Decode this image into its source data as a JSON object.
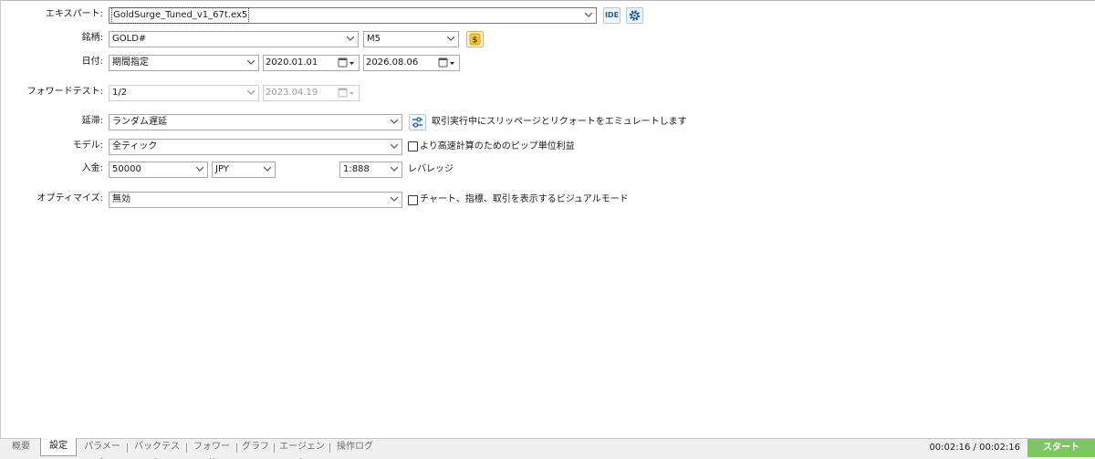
{
  "form": {
    "expert": {
      "label": "エキスパート:",
      "value": "GoldSurge_Tuned_v1_67t.ex5"
    },
    "symbol": {
      "label": "銘柄:",
      "value": "GOLD#",
      "timeframe": "M5"
    },
    "date": {
      "label": "日付:",
      "mode": "期間指定",
      "from": "2020.01.01",
      "to": "2026.08.06"
    },
    "forward": {
      "label": "フォワードテスト:",
      "value": "1/2",
      "date": "2023.04.19"
    },
    "delay": {
      "label": "延滞:",
      "value": "ランダム遅延",
      "note": "取引実行中にスリッページとリクォートをエミュレートします"
    },
    "model": {
      "label": "モデル:",
      "value": "全ティック",
      "checkbox_label": "より高速計算のためのピップ単位利益"
    },
    "deposit": {
      "label": "入金:",
      "amount": "50000",
      "currency": "JPY",
      "leverage": "1:888",
      "leverage_label": "レバレッジ"
    },
    "optimize": {
      "label": "オプティマイズ:",
      "value": "無効",
      "checkbox_label": "チャート、指標、取引を表示するビジュアルモード"
    }
  },
  "icons": {
    "ide_text": "IDE"
  },
  "tabs": [
    "概要",
    "設定",
    "パラメータ",
    "バックテスト",
    "フォワード",
    "グラフ",
    "エージェント",
    "操作ログ"
  ],
  "active_tab": "設定",
  "status": {
    "time": "00:02:16 / 00:02:16",
    "start_label": "スタート"
  },
  "colors": {
    "start_button": "#7cc764",
    "coin": "#f5c542",
    "icon_blue": "#1f5fa8"
  }
}
